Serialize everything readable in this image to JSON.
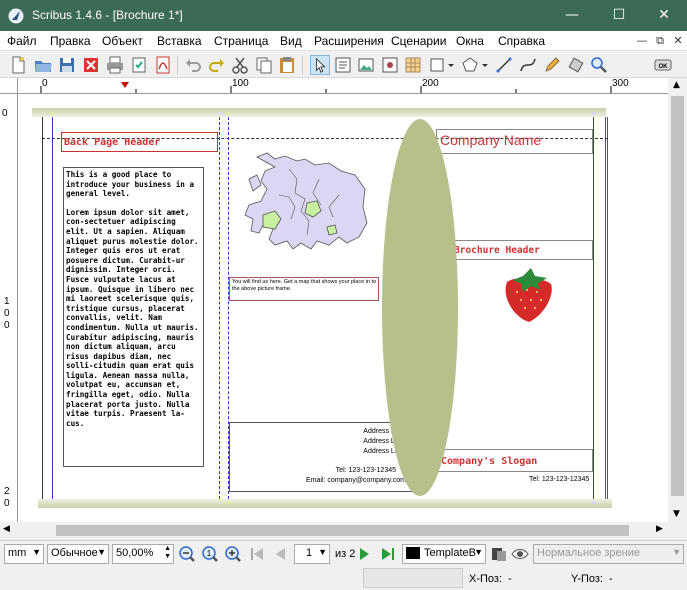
{
  "window": {
    "title": "Scribus 1.4.6 - [Brochure 1*]",
    "minimize": "—",
    "maximize": "☐",
    "close": "✕"
  },
  "menu": [
    "Файл",
    "Правка",
    "Объект",
    "Вставка",
    "Страница",
    "Вид",
    "Расширения",
    "Сценарии",
    "Окна",
    "Справка"
  ],
  "mdi_buttons": [
    "—",
    "⧉",
    "✕"
  ],
  "ruler": {
    "h_labels": [
      "0",
      "100",
      "200",
      "300"
    ],
    "v_labels": [
      "0",
      "1",
      "0",
      "0",
      "2",
      "0"
    ]
  },
  "document": {
    "back_header": "Back Page Header",
    "body_intro": "This is a good place to introduce your business in a general level.",
    "body_lorem": "Lorem ipsum dolor sit amet, con-sectetuer adipiscing elit. Ut a sapien. Aliquam aliquet purus molestie dolor. Integer quis eros ut erat posuere dictum. Curabit-ur dignissim. Integer orci. Fusce vulputate lacus at ipsum. Quisque in libero nec mi laoreet scelerisque quis, tristique cursus, placerat convallis, velit. Nam condimentum. Nulla ut mauris. Curabitur adipiscing, mauris non dictum aliquam, arcu risus dapibus diam, nec solli-citudin quam erat quis ligula. Aenean massa nulla, volutpat eu, accumsan et, fringilla eget, odio. Nulla placerat porta justo. Nulla vitae turpis. Praesent la-cus.",
    "map_caption": "You will find us here. Get a map that shows your place in to the above picture frame.",
    "address1": "Address Line 1",
    "address2": "Address Line 2",
    "address3": "Address Line 3",
    "tel": "Tel: 123-123-12345",
    "email": "Email: company@company.com",
    "company_name": "Company Name",
    "brochure_header": "Brochure Header",
    "slogan": "Company's Slogan",
    "tel_right": "Tel: 123-123-12345"
  },
  "statusbar": {
    "unit": "mm",
    "mode": "Обычное",
    "zoom": "50,00%",
    "page": "1",
    "of_pages": "из 2",
    "layer": "TemplateB",
    "view_mode": "Нормальное зрение"
  },
  "coords": {
    "x_label": "X-Поз:",
    "x_value": "-",
    "y_label": "Y-Поз:",
    "y_value": "-"
  },
  "colors": {
    "titlebar": "#3c6b55",
    "accent_red": "#cc3333",
    "ellipse": "#b7c08a",
    "map_fill": "#ddd6f3",
    "map_green": "#c8f0a0"
  }
}
